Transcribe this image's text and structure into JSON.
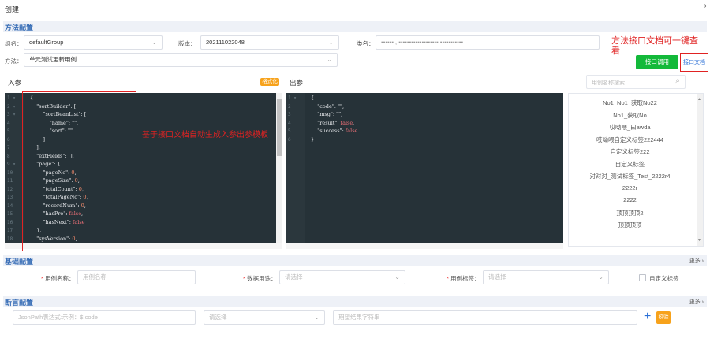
{
  "page": {
    "title": "创建",
    "close_icon": "›"
  },
  "sections": {
    "method": {
      "label": "方法配置"
    },
    "basic": {
      "label": "基础配置",
      "more": "更多 ›"
    },
    "assert": {
      "label": "断言配置",
      "more": "更多 ›"
    }
  },
  "method_config": {
    "group_label": "组名：",
    "group_value": "defaultGroup",
    "version_label": "版本：",
    "version_value": "202111022048",
    "class_label": "类名：",
    "class_value": "▪▪▪▪▪▪ , ▪▪▪▪▪▪▪▪▪▪▪▪▪▪▪▪▪▪▪ ▪▪▪▪▪▪▪▪▪▪▪",
    "method_label": "方法：",
    "method_value": "单元测试更新用例",
    "invoke_button": "接口调用",
    "doc_button": "接口文档"
  },
  "annotations": {
    "doc_note_line1": "方法接口文档可一键查",
    "doc_note_line2": "看",
    "editor_note": "基于接口文档自动生成入参出参模板"
  },
  "input_editor": {
    "label": "入参",
    "format_button": "格式化",
    "line_numbers": [
      "1 ▾",
      "2 ▾",
      "3 ▾",
      "4",
      "5",
      "6",
      "7",
      "8",
      "9 ▾",
      "10",
      "11",
      "12",
      "13",
      "14",
      "15",
      "16",
      "17",
      "18"
    ],
    "lines": [
      "{",
      "    \"sortBuilder\": [",
      "        \"sortBeanList\": [",
      "            \"name\": \"\",",
      "            \"sort\": \"\"",
      "        ]",
      "    ],",
      "    \"extFields\": [],",
      "    \"page\": {",
      "        \"pageNo\": 0,",
      "        \"pageSize\": 0,",
      "        \"totalCount\": 0,",
      "        \"totalPageNo\": 0,",
      "        \"recordNum\": 0,",
      "        \"hasPre\": false,",
      "        \"hasNext\": false",
      "    },",
      "    \"sysVersion\": 0,"
    ]
  },
  "output_editor": {
    "label": "出参",
    "line_numbers": [
      "1 ▾",
      "2",
      "3",
      "4",
      "5",
      "6"
    ],
    "lines": [
      "{",
      "    \"code\": \"\",",
      "    \"msg\": \"\",",
      "    \"result\": false,",
      "    \"success\": false",
      "}"
    ]
  },
  "case_list": {
    "search_placeholder": "用例名称搜索",
    "items": [
      "No1_No1_获取No22",
      "No1_获取No",
      "哎呦喂_曰awda",
      "哎呦喂自定义标签222444",
      "自定义标签222",
      "自定义标签",
      "对对对_测试标签_Test_2222r4",
      "2222r",
      "2222",
      "顶顶顶顶2",
      "顶顶顶顶"
    ]
  },
  "basic_config": {
    "case_name_label": "用例名称：",
    "case_name_placeholder": "用例名称",
    "data_use_label": "数据用途：",
    "data_use_placeholder": "请选择",
    "case_tag_label": "用例标签：",
    "case_tag_placeholder": "请选择",
    "custom_tag_label": "自定义标签"
  },
  "assert_config": {
    "jsonpath_placeholder": "JsonPath表达式:示例：$.code",
    "operator_placeholder": "请选择",
    "expected_placeholder": "期望结果字符串",
    "add_icon": "+",
    "verify_button": "校验"
  }
}
